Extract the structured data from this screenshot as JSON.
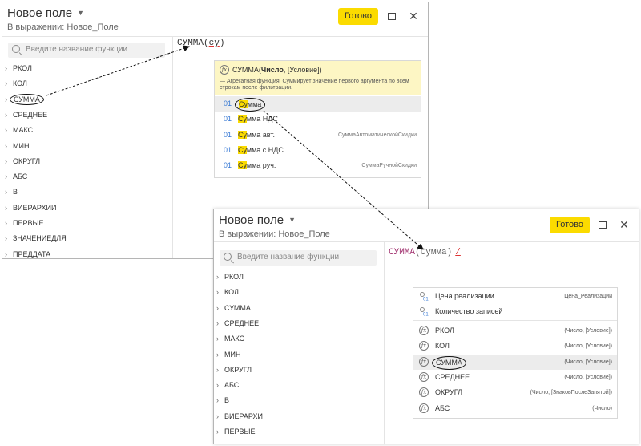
{
  "window1": {
    "title": "Новое поле",
    "subtitle": "В выражении: Новое_Поле",
    "done_label": "Готово",
    "search_placeholder": "Введите название функции",
    "expression": {
      "fn": "СУММА",
      "open": "(",
      "typed": "су",
      "close": ")"
    },
    "functions": [
      "РКОЛ",
      "КОЛ",
      "СУММА",
      "СРЕДНЕЕ",
      "МАКС",
      "МИН",
      "ОКРУГЛ",
      "АБС",
      "В",
      "ВИЕРАРХИИ",
      "ПЕРВЫЕ",
      "ЗНАЧЕНИЕДЛЯ",
      "ПРЕДДАТА"
    ],
    "tooltip": {
      "sig_fn": "СУММА(",
      "sig_arg": "Число",
      "sig_rest": ", [Условие])",
      "description": "— Агрегатная функция. Суммирует значение первого аргумента по всем строкам после фильтрации."
    },
    "suggestions": [
      {
        "code": "01",
        "hl": "Су",
        "rest": "мма",
        "right": ""
      },
      {
        "code": "01",
        "hl": "Су",
        "rest": "мма НДС",
        "right": ""
      },
      {
        "code": "01",
        "hl": "Су",
        "rest": "мма авт.",
        "right": "СуммаАвтоматическойСкидки"
      },
      {
        "code": "01",
        "hl": "Су",
        "rest": "мма с НДС",
        "right": ""
      },
      {
        "code": "01",
        "hl": "Су",
        "rest": "мма руч.",
        "right": "СуммаРучнойСкидки"
      }
    ]
  },
  "window2": {
    "title": "Новое поле",
    "subtitle": "В выражении: Новое_Поле",
    "done_label": "Готово",
    "search_placeholder": "Введите название функции",
    "expression": {
      "fn": "СУММА",
      "open": "(",
      "arg": "Сумма",
      "close": ")",
      "op": "/"
    },
    "functions": [
      "РКОЛ",
      "КОЛ",
      "СУММА",
      "СРЕДНЕЕ",
      "МАКС",
      "МИН",
      "ОКРУГЛ",
      "АБС",
      "В",
      "ВИЕРАРХИ",
      "ПЕРВЫЕ"
    ],
    "fields": [
      {
        "name": "Цена реализации",
        "right": "Цена_Реализации"
      },
      {
        "name": "Количество записей",
        "right": ""
      }
    ],
    "autocomplete": [
      {
        "name": "РКОЛ",
        "right": "(Число, [Условие])"
      },
      {
        "name": "КОЛ",
        "right": "(Число, [Условие])"
      },
      {
        "name": "СУММА",
        "right": "(Число, [Условие])"
      },
      {
        "name": "СРЕДНЕЕ",
        "right": "(Число, [Условие])"
      },
      {
        "name": "ОКРУГЛ",
        "right": "(Число, [ЗнаковПослеЗапятой])"
      },
      {
        "name": "АБС",
        "right": "(Число)"
      }
    ]
  },
  "icons": {
    "dropdown": "caret-down-icon",
    "maximize": "maximize-icon",
    "close": "close-icon",
    "search": "search-icon",
    "function": "fx-icon",
    "field": "field-icon",
    "chevron": "chevron-right-icon"
  },
  "colors": {
    "accent": "#fbdb00",
    "highlight": "#fbdb00",
    "tooltip_bg": "#fdf6c4",
    "code_blue": "#3a7bd5",
    "function_name": "#a0306e",
    "error_red": "#dd3333"
  }
}
